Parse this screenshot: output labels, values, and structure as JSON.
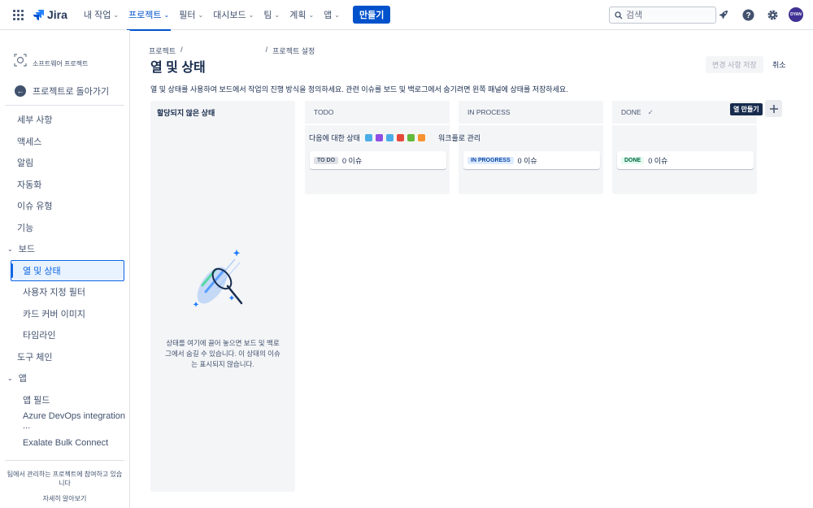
{
  "topnav": {
    "app_name": "Jira",
    "items": [
      {
        "label": "내 작업",
        "active": false
      },
      {
        "label": "프로젝트",
        "active": true
      },
      {
        "label": "필터",
        "active": false
      },
      {
        "label": "대시보드",
        "active": false
      },
      {
        "label": "팀",
        "active": false
      },
      {
        "label": "계획",
        "active": false
      },
      {
        "label": "앱",
        "active": false
      }
    ],
    "create_label": "만들기",
    "search_placeholder": "검색",
    "avatar_initials": "DYAN"
  },
  "sidebar": {
    "project_type": "소프트웨어 프로젝트",
    "back_label": "프로젝트로 돌아가기",
    "items": [
      {
        "label": "세부 사항"
      },
      {
        "label": "액세스"
      },
      {
        "label": "알림"
      },
      {
        "label": "자동화"
      },
      {
        "label": "이슈 유형"
      },
      {
        "label": "기능"
      },
      {
        "label": "보드"
      },
      {
        "label": "열 및 상태"
      },
      {
        "label": "사용자 지정 필터"
      },
      {
        "label": "카드 커버 이미지"
      },
      {
        "label": "타임라인"
      },
      {
        "label": "도구 체인"
      },
      {
        "label": "앱"
      },
      {
        "label": "앱 필드"
      },
      {
        "label": "Azure DevOps integration ..."
      },
      {
        "label": "Exalate Bulk Connect"
      }
    ],
    "footer_text": "팀에서 관리하는 프로젝트에 참여하고 있습니다",
    "footer_link": "자세히 알아보기"
  },
  "main": {
    "breadcrumb": [
      "프로젝트",
      "프로젝트 설정"
    ],
    "title": "열 및 상태",
    "save_label": "변경 사항 저장",
    "cancel_label": "취소",
    "description": "열 및 상태를 사용하여 보드에서 작업의 진행 방식을 정의하세요. 관련 이슈를 보드 및 백로그에서 숨기려면 왼쪽 패널에 상태를 저장하세요.",
    "unassigned_title": "할당되지 않은 상태",
    "unassigned_message": "상태를 여기에 끌어 놓으면 보드 및 백로그에서 숨길 수 있습니다. 이 상태의 이슈는 표시되지 않습니다.",
    "workflow_label": "다음에 대한 상태",
    "workflow_manage": "워크플로 관리",
    "add_column_tooltip": "열 만들기",
    "columns": [
      {
        "name": "TODO",
        "status": "TO DO",
        "issues": "0 이슈"
      },
      {
        "name": "IN PROCESS",
        "status": "IN PROGRESS",
        "issues": "0 이슈"
      },
      {
        "name": "DONE",
        "status": "DONE",
        "issues": "0 이슈"
      }
    ]
  },
  "colors": {
    "brand": "#0052cc",
    "selected": "#0c66e4",
    "issue_type_icons": [
      "#4bade8",
      "#904ee2",
      "#4bade8",
      "#e5493a",
      "#63ba3c",
      "#f79232"
    ]
  }
}
